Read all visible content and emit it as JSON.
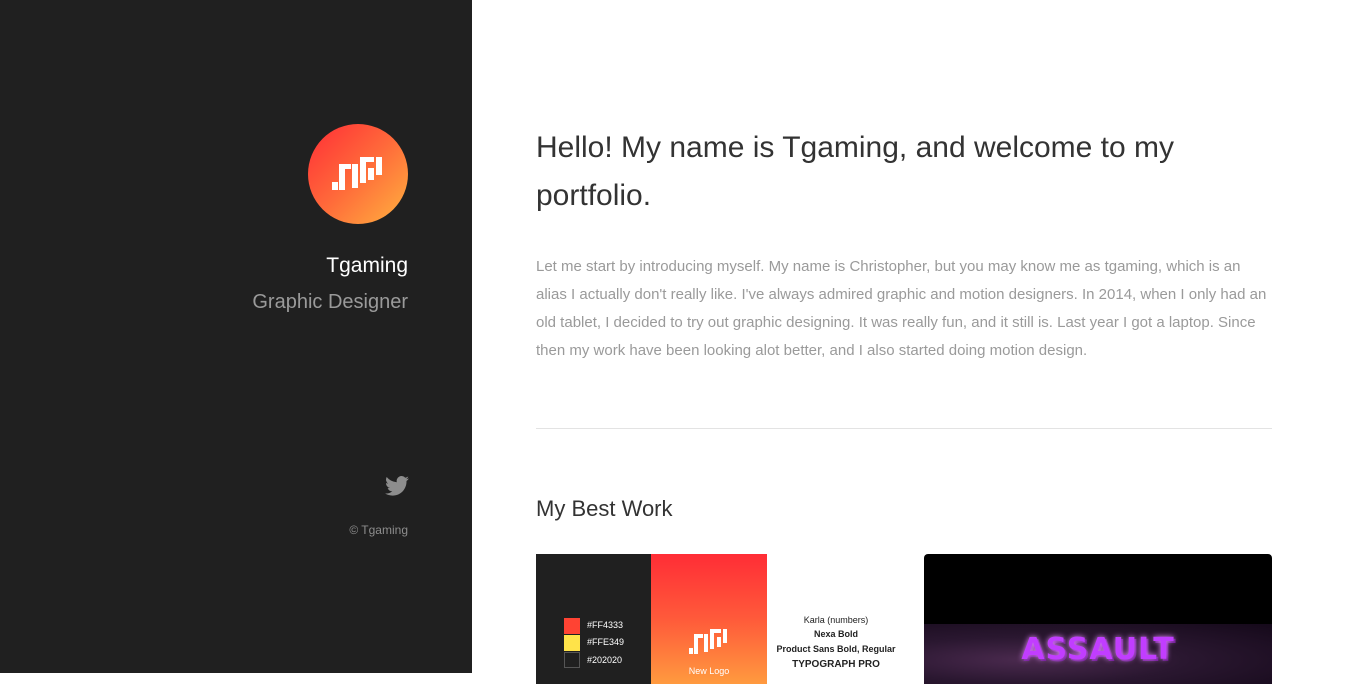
{
  "sidebar": {
    "name": "Tgaming",
    "role": "Graphic Designer",
    "twitter_icon": "twitter-icon",
    "copyright": "© Tgaming",
    "avatar_icon": "logo-icon"
  },
  "main": {
    "intro_title": "Hello! My name is Tgaming, and welcome to my portfolio.",
    "intro_body": "Let me start by introducing myself. My name is Christopher, but you may know me as tgaming, which is an alias I actually don't really like. I've always admired graphic and motion designers. In 2014, when I only had an old tablet, I decided to try out graphic designing. It was really fun, and it still is. Last year I got a laptop. Since then my work have been looking alot better, and I also started doing motion design.",
    "section_title": "My Best Work",
    "works": [
      {
        "swatches": [
          {
            "label": "#FF4333",
            "color": "#ff4333"
          },
          {
            "label": "#FFE349",
            "color": "#ffe349"
          },
          {
            "label": "#202020",
            "color": "#202020"
          }
        ],
        "logo_caption": "New Logo",
        "type_lines": [
          "Karla (numbers)",
          "Nexa Bold",
          "Product Sans Bold, Regular",
          "TYPOGRAPH PRO"
        ]
      },
      {
        "title": "ASSAULT"
      }
    ]
  },
  "colors": {
    "sidebar_bg": "#202020",
    "accent_start": "#ff2d36",
    "accent_end": "#ffb23f"
  }
}
